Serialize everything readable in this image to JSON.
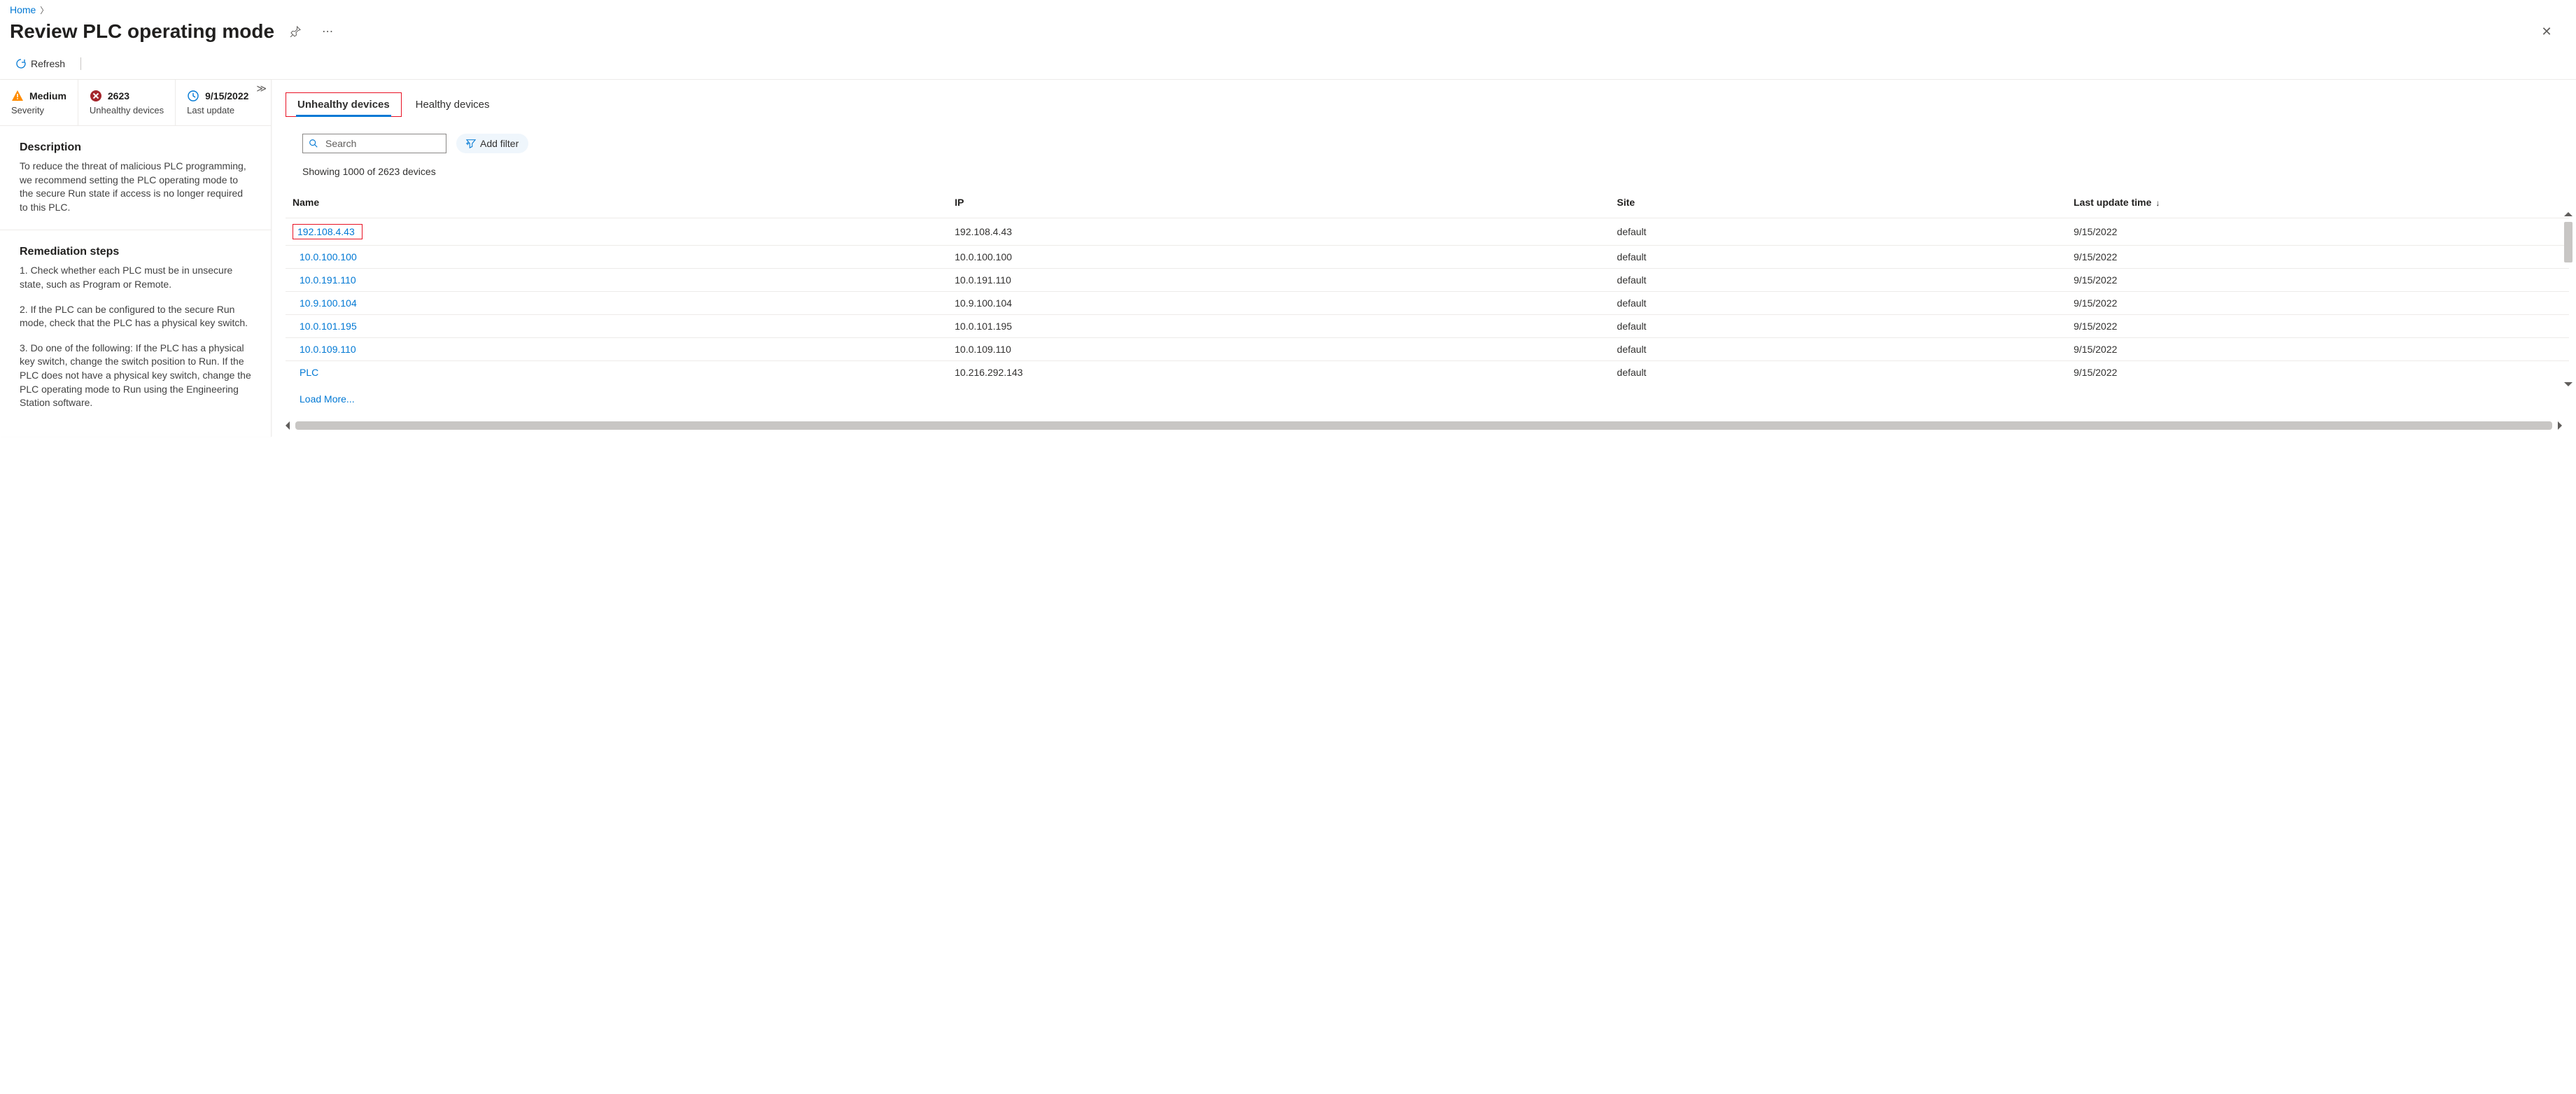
{
  "breadcrumb": {
    "home": "Home"
  },
  "title": "Review PLC operating mode",
  "toolbar": {
    "refresh": "Refresh"
  },
  "metrics": {
    "severity": {
      "value": "Medium",
      "label": "Severity"
    },
    "unhealthy": {
      "value": "2623",
      "label": "Unhealthy devices"
    },
    "updated": {
      "value": "9/15/2022",
      "label": "Last update"
    }
  },
  "description": {
    "heading": "Description",
    "body": "To reduce the threat of malicious PLC programming, we recommend setting the PLC operating mode to the secure Run state if access is no longer required to this PLC."
  },
  "remediation": {
    "heading": "Remediation steps",
    "step1": "1. Check whether each PLC must be in unsecure state, such as Program or Remote.",
    "step2": "2. If the PLC can be configured to the secure Run mode, check that the PLC has a physical key switch.",
    "step3": "3. Do one of the following: If the PLC has a physical key switch, change the switch position to Run. If the PLC does not have a physical key switch, change the PLC operating mode to Run using the Engineering Station software."
  },
  "tabs": {
    "unhealthy": "Unhealthy devices",
    "healthy": "Healthy devices"
  },
  "filters": {
    "search_placeholder": "Search",
    "add_filter": "Add filter"
  },
  "count_line": "Showing 1000 of 2623 devices",
  "columns": {
    "name": "Name",
    "ip": "IP",
    "site": "Site",
    "time": "Last update time"
  },
  "rows": [
    {
      "name": "192.108.4.43",
      "ip": "192.108.4.43",
      "site": "default",
      "time": "9/15/2022"
    },
    {
      "name": "10.0.100.100",
      "ip": "10.0.100.100",
      "site": "default",
      "time": "9/15/2022"
    },
    {
      "name": "10.0.191.110",
      "ip": "10.0.191.110",
      "site": "default",
      "time": "9/15/2022"
    },
    {
      "name": "10.9.100.104",
      "ip": "10.9.100.104",
      "site": "default",
      "time": "9/15/2022"
    },
    {
      "name": "10.0.101.195",
      "ip": "10.0.101.195",
      "site": "default",
      "time": "9/15/2022"
    },
    {
      "name": "10.0.109.110",
      "ip": "10.0.109.110",
      "site": "default",
      "time": "9/15/2022"
    },
    {
      "name": "PLC",
      "ip": "10.216.292.143",
      "site": "default",
      "time": "9/15/2022"
    }
  ],
  "load_more": "Load More..."
}
